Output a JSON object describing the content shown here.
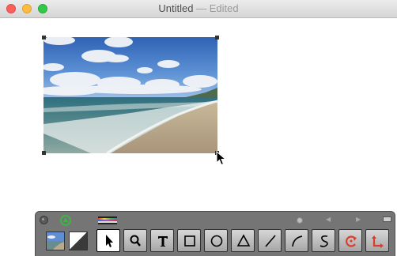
{
  "window": {
    "title": "Untitled",
    "separator": " — ",
    "status": "Edited"
  },
  "canvas": {
    "image_alt": "beach photo",
    "cursor": "arrow-cursor"
  },
  "palette": {
    "icons": [
      "close-icon",
      "recycle-icon",
      "color-bars-icon",
      "slider-dot-icon",
      "prev-arrow-icon",
      "next-arrow-icon",
      "minimize-icon"
    ],
    "prev_glyph": "◀",
    "next_glyph": "▶",
    "tools": [
      {
        "name": "select-tool",
        "icon": "arrow-icon",
        "selected": true
      },
      {
        "name": "zoom-tool",
        "icon": "magnifier-icon",
        "selected": false
      },
      {
        "name": "text-tool",
        "icon": "text-icon",
        "selected": false
      },
      {
        "name": "rectangle-tool",
        "icon": "rectangle-icon",
        "selected": false
      },
      {
        "name": "oval-tool",
        "icon": "circle-icon",
        "selected": false
      },
      {
        "name": "polygon-tool",
        "icon": "triangle-icon",
        "selected": false
      },
      {
        "name": "line-tool",
        "icon": "line-icon",
        "selected": false
      },
      {
        "name": "arc-tool",
        "icon": "arc-icon",
        "selected": false
      },
      {
        "name": "freehand-tool",
        "icon": "squiggle-icon",
        "selected": false
      },
      {
        "name": "rotate-tool",
        "icon": "rotate-icon",
        "selected": false
      },
      {
        "name": "transform-tool",
        "icon": "transform-icon",
        "selected": false
      }
    ],
    "colors": {
      "accent_green": "#3fb34a",
      "accent_red": "#e03b2a"
    }
  }
}
